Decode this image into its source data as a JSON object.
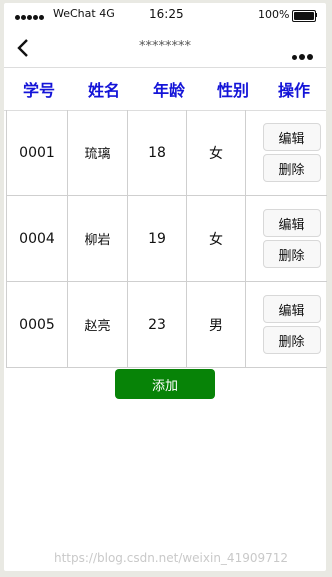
{
  "status_bar": {
    "carrier": "WeChat 4G",
    "time": "16:25",
    "battery": "100%"
  },
  "nav": {
    "title": "********"
  },
  "table": {
    "headers": [
      "学号",
      "姓名",
      "年龄",
      "性别",
      "操作"
    ],
    "rows": [
      {
        "id": "0001",
        "name": "琉璃",
        "age": "18",
        "gender": "女"
      },
      {
        "id": "0004",
        "name": "柳岩",
        "age": "19",
        "gender": "女"
      },
      {
        "id": "0005",
        "name": "赵亮",
        "age": "23",
        "gender": "男"
      }
    ],
    "edit_label": "编辑",
    "delete_label": "删除"
  },
  "add_label": "添加",
  "watermark": "https://blog.csdn.net/weixin_41909712",
  "colors": {
    "header": "#1414d8",
    "add_button": "#078307"
  }
}
